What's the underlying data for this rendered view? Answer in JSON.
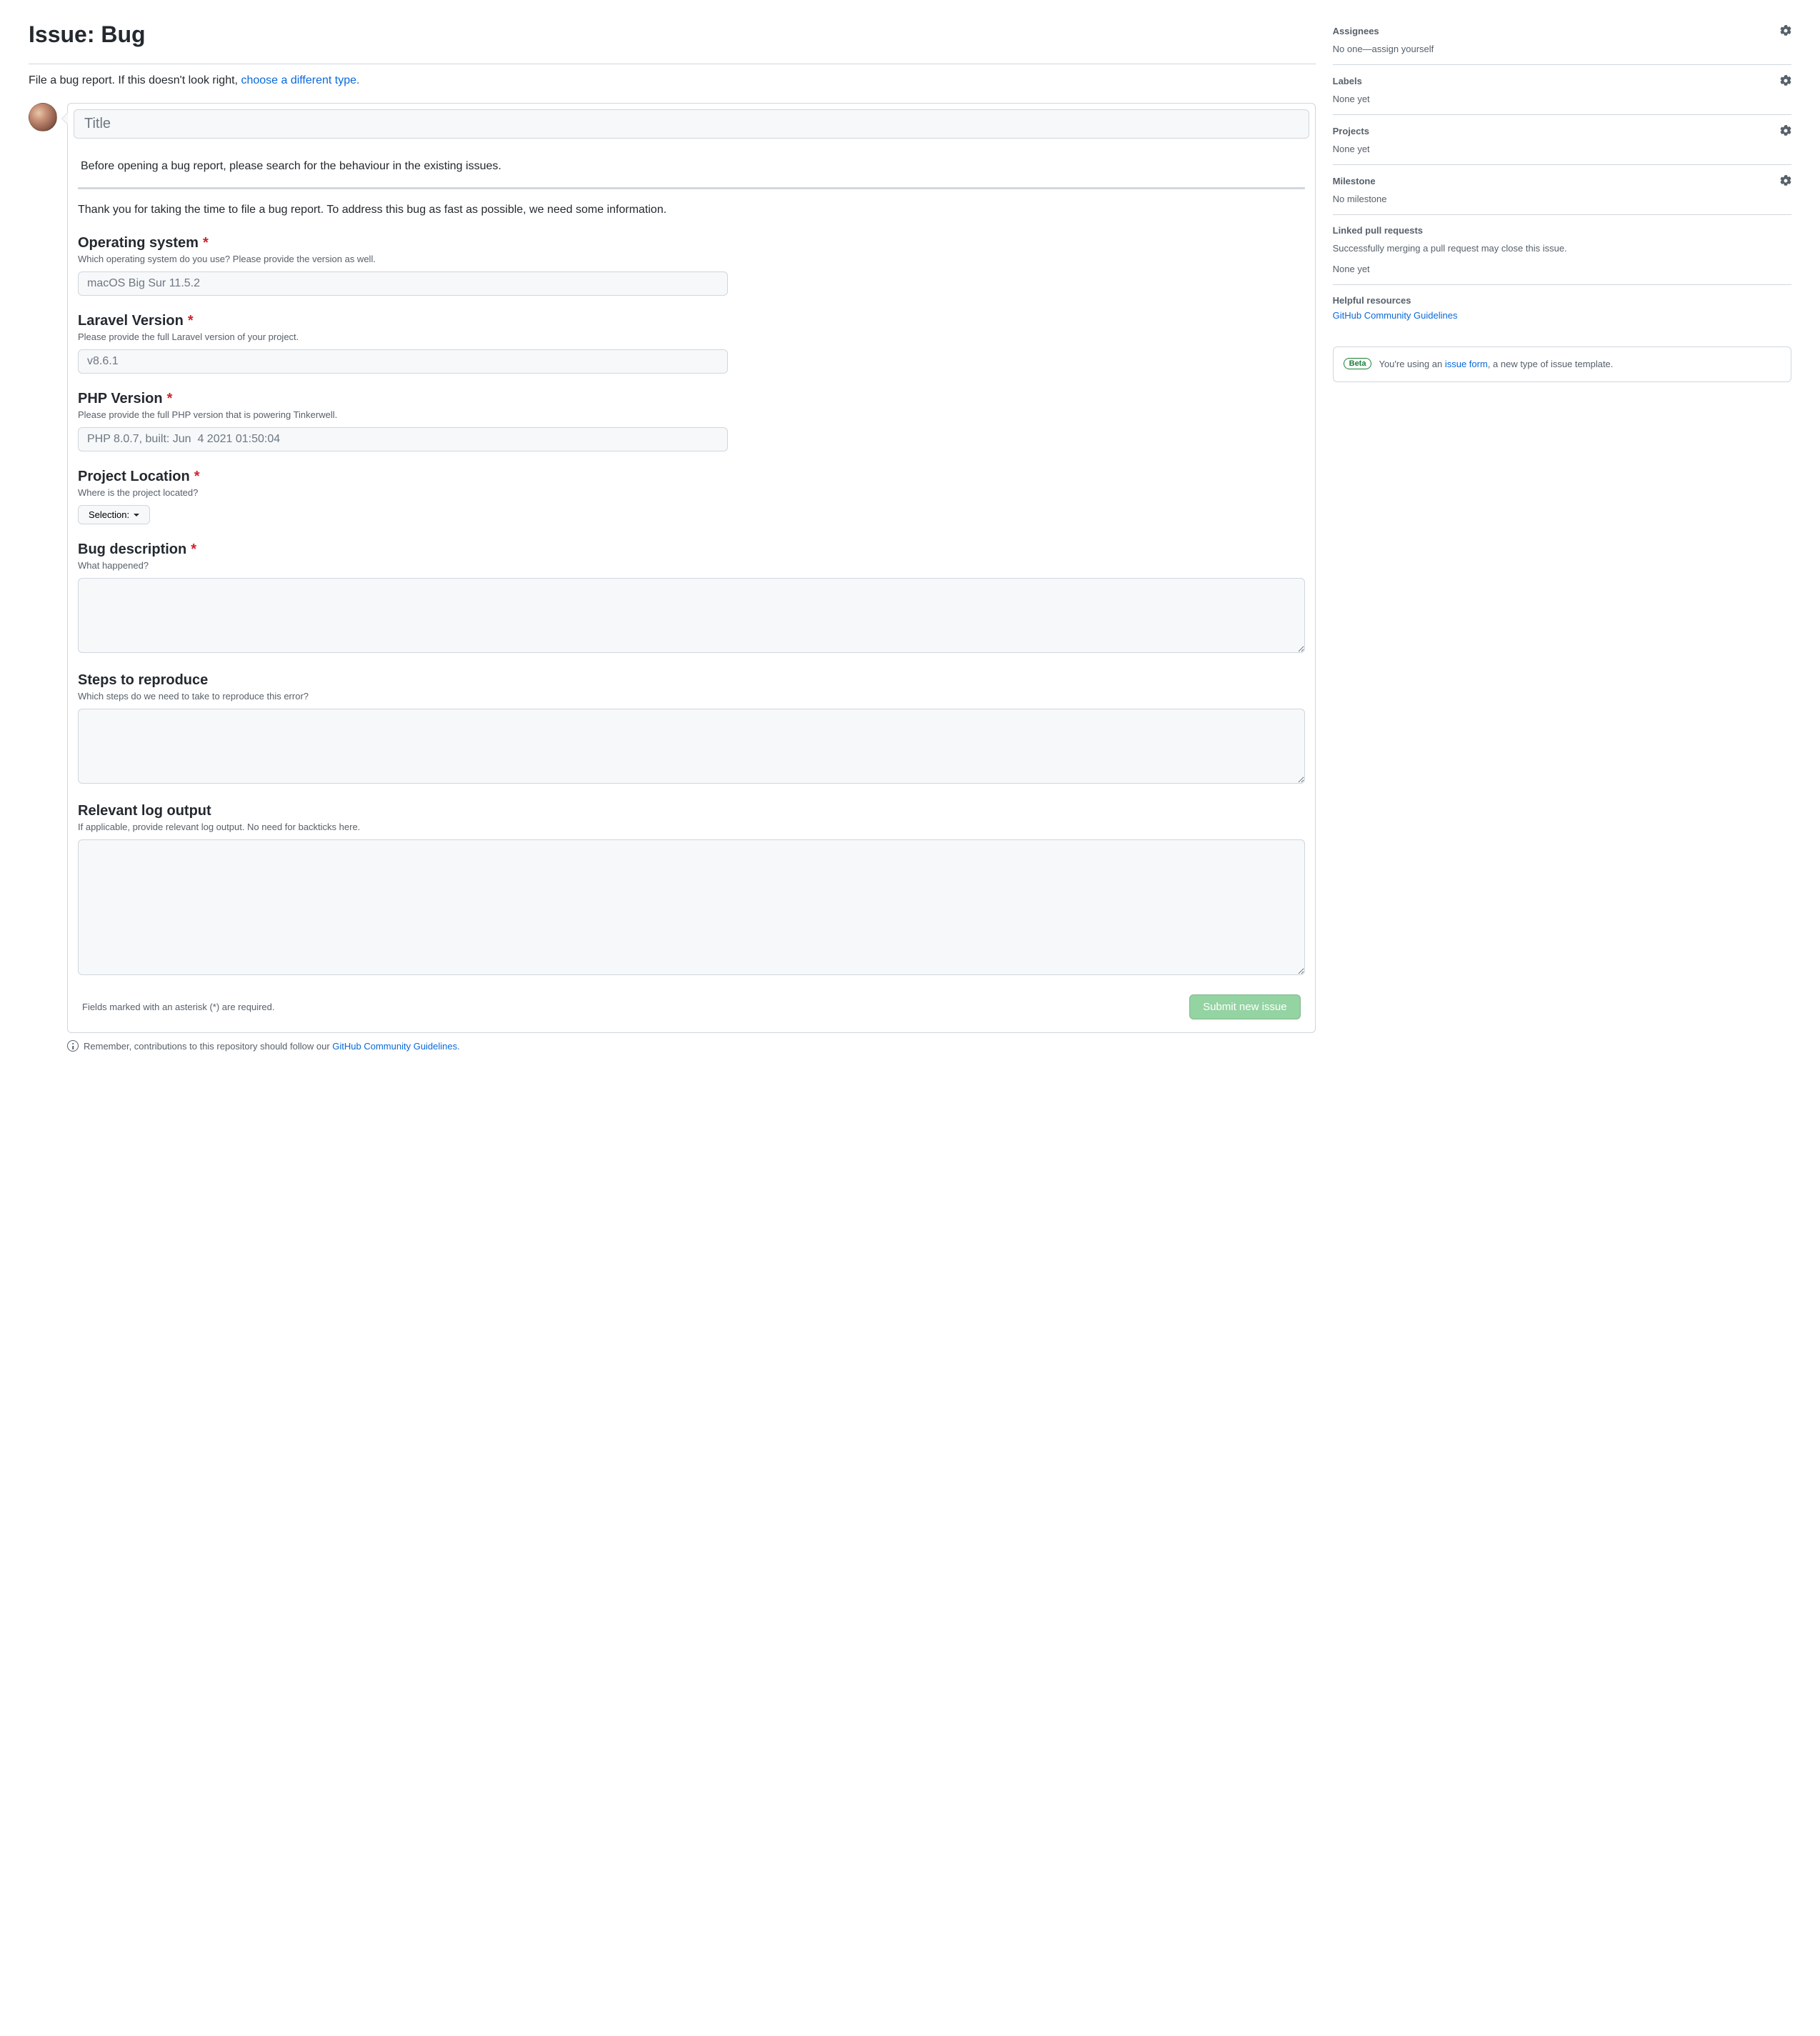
{
  "header": {
    "title": "Issue: Bug"
  },
  "sub": {
    "prefix": "File a bug report. If this doesn't look right, ",
    "link": "choose a different type."
  },
  "form": {
    "title_placeholder": "Title",
    "preface": "Before opening a bug report, please search for the behaviour in the existing issues.",
    "thanks": "Thank you for taking the time to file a bug report. To address this bug as fast as possible, we need some information.",
    "fields": {
      "os": {
        "label": "Operating system",
        "required": true,
        "desc": "Which operating system do you use? Please provide the version as well.",
        "placeholder": "macOS Big Sur 11.5.2"
      },
      "laravel": {
        "label": "Laravel Version",
        "required": true,
        "desc": "Please provide the full Laravel version of your project.",
        "placeholder": "v8.6.1"
      },
      "php": {
        "label": "PHP Version",
        "required": true,
        "desc": "Please provide the full PHP version that is powering Tinkerwell.",
        "placeholder": "PHP 8.0.7, built: Jun  4 2021 01:50:04"
      },
      "loc": {
        "label": "Project Location",
        "required": true,
        "desc": "Where is the project located?",
        "select_label": "Selection:"
      },
      "bug": {
        "label": "Bug description",
        "required": true,
        "desc": "What happened?"
      },
      "steps": {
        "label": "Steps to reproduce",
        "required": false,
        "desc": "Which steps do we need to take to reproduce this error?"
      },
      "log": {
        "label": "Relevant log output",
        "required": false,
        "desc": "If applicable, provide relevant log output. No need for backticks here."
      }
    },
    "footer_note": "Fields marked with an asterisk (*) are required.",
    "submit": "Submit new issue"
  },
  "below": {
    "prefix": "Remember, contributions to this repository should follow our ",
    "link": "GitHub Community Guidelines.",
    "suffix": ""
  },
  "sidebar": {
    "assignees": {
      "title": "Assignees",
      "body": "No one—assign yourself"
    },
    "labels": {
      "title": "Labels",
      "body": "None yet"
    },
    "projects": {
      "title": "Projects",
      "body": "None yet"
    },
    "milestone": {
      "title": "Milestone",
      "body": "No milestone"
    },
    "linked": {
      "title": "Linked pull requests",
      "desc": "Successfully merging a pull request may close this issue.",
      "body": "None yet"
    },
    "help": {
      "title": "Helpful resources",
      "link": "GitHub Community Guidelines"
    }
  },
  "info": {
    "beta": "Beta",
    "prefix": "You're using an ",
    "link": "issue form",
    "suffix": ", a new type of issue template."
  },
  "req_mark": "*"
}
